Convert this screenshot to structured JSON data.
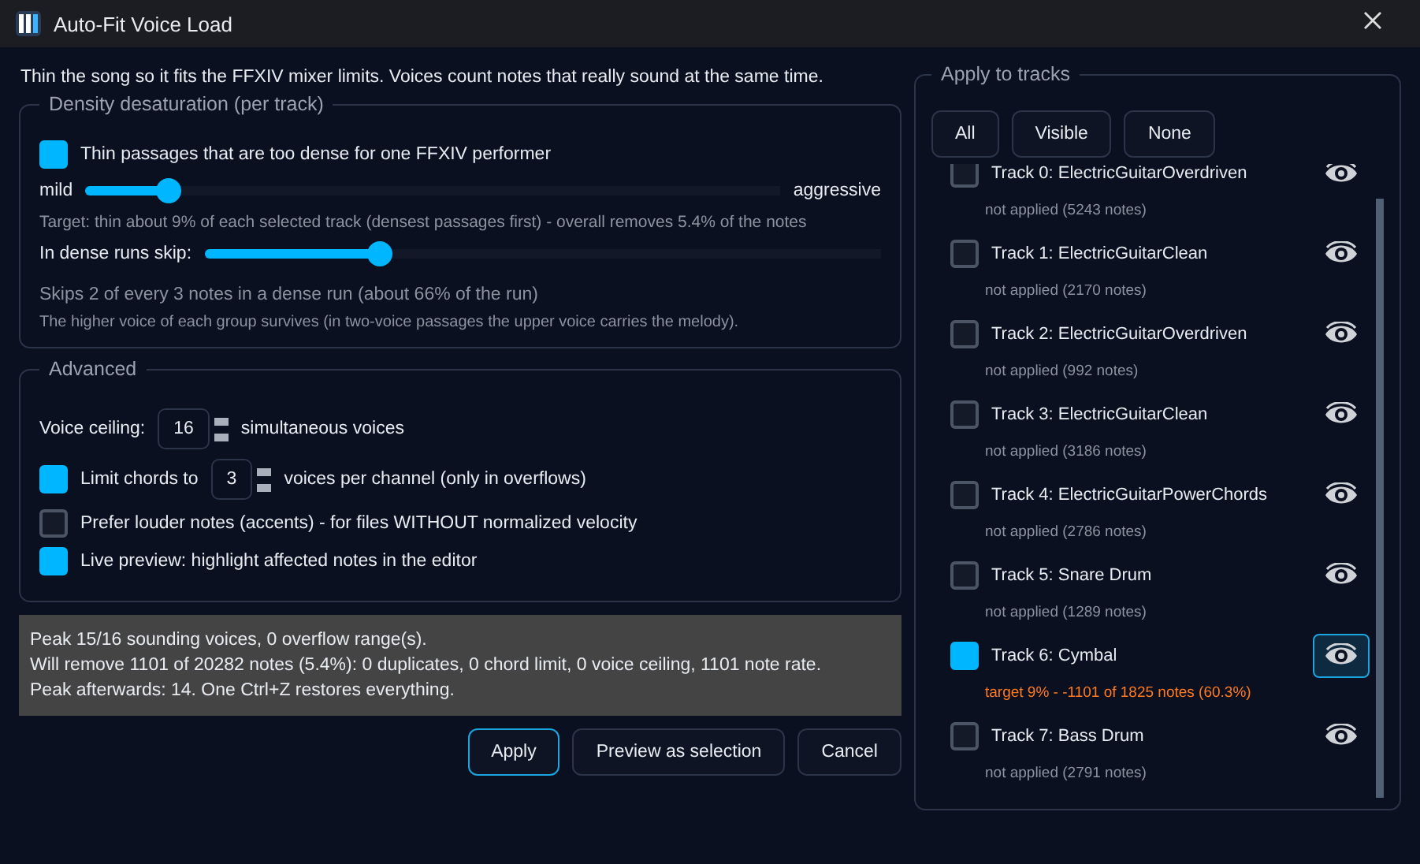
{
  "window": {
    "title": "Auto-Fit Voice Load"
  },
  "intro": "Thin the song so it fits the FFXIV mixer limits. Voices count notes that really sound at the same time.",
  "density": {
    "legend": "Density desaturation (per track)",
    "thin": {
      "label": "Thin passages that are too dense for one FFXIV performer",
      "checked": true
    },
    "strength": {
      "min_label": "mild",
      "max_label": "aggressive",
      "level": 0.12
    },
    "target_text": "Target: thin about 9% of each selected track (densest passages first) - overall removes 5.4% of the notes",
    "skip": {
      "label": "In dense runs skip:",
      "level": 0.26
    },
    "skip_text": "Skips 2 of every 3 notes in a dense run (about 66% of the run)",
    "note": "The higher voice of each group survives (in two-voice passages the upper voice carries the melody)."
  },
  "advanced": {
    "legend": "Advanced",
    "ceiling": {
      "label": "Voice ceiling:",
      "value": "16",
      "suffix": "simultaneous voices"
    },
    "chords": {
      "label": "Limit chords to",
      "checked": true,
      "value": "3",
      "suffix": "voices per channel (only in overflows)"
    },
    "options": [
      {
        "label": "Prefer louder notes (accents) - for files WITHOUT normalized velocity",
        "checked": false
      },
      {
        "label": "Live preview: highlight affected notes in the editor",
        "checked": true
      }
    ]
  },
  "summary": [
    "Peak 15/16 sounding voices, 0 overflow range(s).",
    "Will remove 1101 of 20282 notes (5.4%): 0 duplicates, 0 chord limit, 0 voice ceiling, 1101 note rate.",
    "Peak afterwards: 14. One Ctrl+Z restores everything."
  ],
  "buttons": [
    {
      "label": "Apply",
      "selected": true
    },
    {
      "label": "Preview as selection",
      "selected": false
    },
    {
      "label": "Cancel",
      "selected": false
    }
  ],
  "tracks_panel": {
    "legend": "Apply to tracks",
    "filters": [
      "All",
      "Visible",
      "None"
    ],
    "tracks": [
      {
        "name": "Track 0: ElectricGuitarOverdriven",
        "status": "not applied (5243 notes)",
        "checked": false,
        "eye_selected": false
      },
      {
        "name": "Track 1: ElectricGuitarClean",
        "status": "not applied (2170 notes)",
        "checked": false,
        "eye_selected": false
      },
      {
        "name": "Track 2: ElectricGuitarOverdriven",
        "status": "not applied (992 notes)",
        "checked": false,
        "eye_selected": false
      },
      {
        "name": "Track 3: ElectricGuitarClean",
        "status": "not applied (3186 notes)",
        "checked": false,
        "eye_selected": false
      },
      {
        "name": "Track 4: ElectricGuitarPowerChords",
        "status": "not applied (2786 notes)",
        "checked": false,
        "eye_selected": false
      },
      {
        "name": "Track 5: Snare Drum",
        "status": "not applied (1289 notes)",
        "checked": false,
        "eye_selected": false
      },
      {
        "name": "Track 6: Cymbal",
        "status": "target 9% - -1101 of 1825 notes (60.3%)",
        "checked": true,
        "eye_selected": true
      },
      {
        "name": "Track 7: Bass Drum",
        "status": "not applied (2791 notes)",
        "checked": false,
        "eye_selected": false
      }
    ]
  }
}
